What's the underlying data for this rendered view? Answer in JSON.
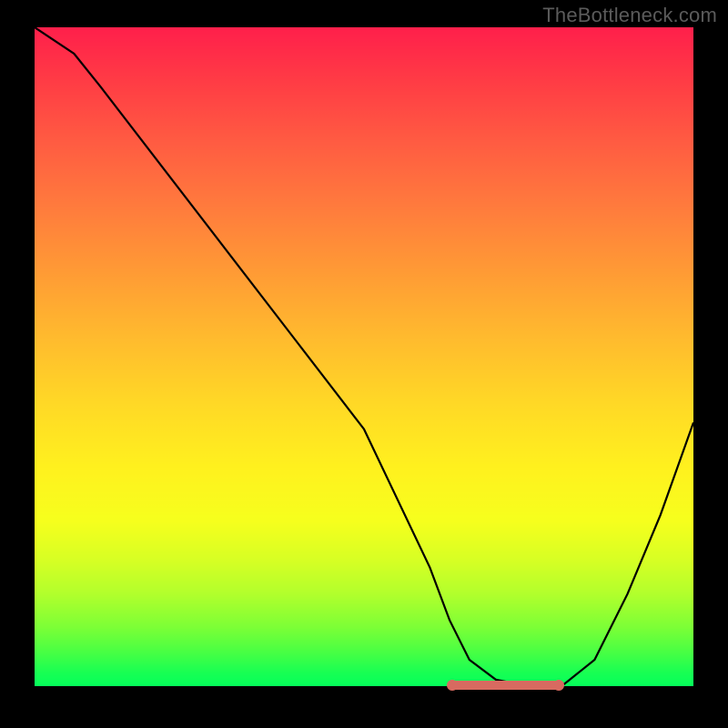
{
  "watermark": "TheBottleneck.com",
  "chart_data": {
    "type": "line",
    "title": "",
    "xlabel": "",
    "ylabel": "",
    "xlim": [
      0,
      100
    ],
    "ylim": [
      0,
      100
    ],
    "series": [
      {
        "name": "curve",
        "x": [
          0,
          6,
          10,
          20,
          30,
          40,
          50,
          60,
          63,
          66,
          70,
          75,
          80,
          85,
          90,
          95,
          100
        ],
        "values": [
          100,
          96,
          91,
          78,
          65,
          52,
          39,
          18,
          10,
          4,
          1,
          0,
          0,
          4,
          14,
          26,
          40
        ]
      }
    ],
    "valley_highlight": {
      "x_start": 63,
      "x_end": 80,
      "y": 0
    }
  }
}
